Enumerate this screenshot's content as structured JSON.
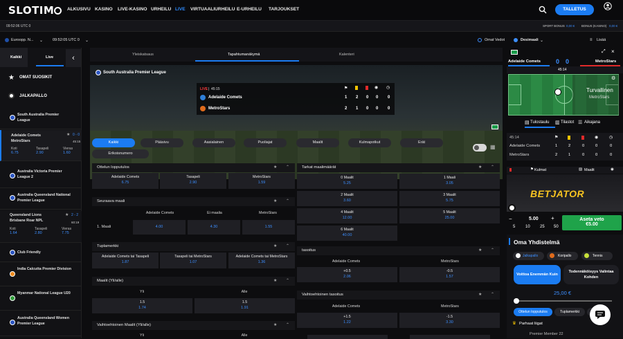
{
  "nav": {
    "logo": "SLOTIM",
    "items": [
      "ALKUSIVU",
      "KASINO",
      "LIVE-KASINO",
      "URHEILU",
      "LIVE",
      "VIRTUAALIURHEILU",
      "E-URHEILU",
      "TARJOUKSET"
    ],
    "deposit": "TALLETUS"
  },
  "subbar": {
    "time_left": "09:52:06 UTC 0",
    "bonus_sport": "SPORT BONUS",
    "bonus_sport_val": "0,00 €",
    "bonus_casino": "BONUS (KASINO)",
    "bonus_casino_val": "0,00 €"
  },
  "filterbar": {
    "region": "Euroopp. N...",
    "time": "09:52:05 UTC 0",
    "own_bets": "Omat Vedot",
    "decimal": "Desimaali",
    "more": "Lisää"
  },
  "sidebar": {
    "tab_all": "Kaikki",
    "tab_live": "Live",
    "favorites": "OMAT SUOSIKIT",
    "football": "JALKAPALLO",
    "items": [
      {
        "label": "South Australia Premier League"
      },
      {
        "label": "Adelaide Comets",
        "label2": "MetroStars",
        "score": "0 - 0",
        "time": "45:15",
        "odds": [
          {
            "l": "Koti",
            "v": "6.75"
          },
          {
            "l": "Tasapeli",
            "v": "2.90"
          },
          {
            "l": "Vieras",
            "v": "1.60"
          }
        ]
      },
      {
        "label": "Australia Victoria Premier League 2"
      },
      {
        "label": "Australia Queensland National Premier League"
      },
      {
        "label": "Queensland Lions",
        "label2": "Brisbane Roar NPL",
        "score": "2 - 2",
        "time": "60:19",
        "odds": [
          {
            "l": "Koti",
            "v": "1.64"
          },
          {
            "l": "Tasapeli",
            "v": "2.80"
          },
          {
            "l": "Vieras",
            "v": "7.75"
          }
        ]
      },
      {
        "label": "Club Friendly"
      },
      {
        "label": "India Calcutta Premier Division"
      },
      {
        "label": "Myanmar National League U20"
      },
      {
        "label": "Australia Queensland Women Premier League"
      }
    ]
  },
  "middle": {
    "tabs": [
      "Yleiskatsaus",
      "Tapahtumanäkymä",
      "Kalenteri"
    ],
    "league": "South Australia Premier League",
    "live": "LIVE",
    "live_time": "45:15",
    "teams": [
      {
        "name": "Adelaide Comets",
        "s": [
          "1",
          "2",
          "0",
          "0",
          "0"
        ]
      },
      {
        "name": "MetroStars",
        "s": [
          "2",
          "1",
          "0",
          "0",
          "0"
        ]
      }
    ],
    "chips": [
      "Kaikki",
      "Pääsivu",
      "Aasialainen",
      "Puoliajat",
      "Maalit",
      "Kulmapotkut",
      "Erät",
      "Erikoisnumero"
    ],
    "m1": {
      "title": "Ottelun lopputulos",
      "cells": [
        {
          "n": "Adelaide Comets",
          "o": "6.75"
        },
        {
          "n": "Tasapeli",
          "o": "2.90"
        },
        {
          "n": "MetroStars",
          "o": "1.59"
        }
      ]
    },
    "m2": {
      "title": "Seuraava maali",
      "cols": [
        "Adelaide Comets",
        "Ei maalia",
        "MetroStars"
      ],
      "row": "1. Maali",
      "odds": [
        "4.00",
        "4.30",
        "1.55"
      ]
    },
    "m3": {
      "title": "Tuplamerkki",
      "cells": [
        {
          "n": "Adelaide Comets tai Tasapeli",
          "o": "1.87"
        },
        {
          "n": "Tasapeli tai MetroStars",
          "o": "1.07"
        },
        {
          "n": "Adelaide Comets tai MetroStars",
          "o": "1.36"
        }
      ]
    },
    "m4": {
      "title": "Maalit (Yli/alle)",
      "cols": [
        "Yli",
        "Alle"
      ],
      "line": "1.5",
      "odds": [
        "1.74",
        "1.91"
      ]
    },
    "m5": {
      "title": "Vaihtoehtoinen Maalit (Yli/alle)",
      "cols": [
        "Yli",
        "Alle"
      ]
    },
    "r1": {
      "title": "Tarkat maalimäärät",
      "cells": [
        {
          "n": "0 Maalit",
          "o": "5.25"
        },
        {
          "n": "1 Maali",
          "o": "3.05"
        },
        {
          "n": "2 Maalit",
          "o": "3.60"
        },
        {
          "n": "3 Maalit",
          "o": "5.75"
        },
        {
          "n": "4 Maalit",
          "o": "12.00"
        },
        {
          "n": "5 Maalit",
          "o": "25.00"
        },
        {
          "n": "6 Maalit",
          "o": "40.00"
        }
      ]
    },
    "r2": {
      "title": "tasoitus",
      "cols": [
        "Adelaide Comets",
        "MetroStars"
      ],
      "cells": [
        {
          "n": "+0.5",
          "o": "2.06"
        },
        {
          "n": "-0.5",
          "o": "1.57"
        }
      ]
    },
    "r3": {
      "title": "Vaihtoehtoinen tasoitus",
      "cols": [
        "Adelaide Comets",
        "MetroStars"
      ],
      "cells": [
        {
          "n": "+1.5",
          "o": "1.22"
        },
        {
          "n": "-1.5",
          "o": "3.30"
        }
      ]
    }
  },
  "right": {
    "home": "Adelaide Comets",
    "away": "MetroStars",
    "hs": "0",
    "as": "0",
    "time": "45:14",
    "pitch_text": "Turvallinen",
    "pitch_team": "MetroStars",
    "tabs": [
      "Tulostaulu",
      "Tilastot",
      "Aikajana"
    ],
    "st_time": "45:14",
    "rows": [
      {
        "n": "Adelaide Comets",
        "s": [
          "1",
          "2",
          "0",
          "0",
          "0"
        ]
      },
      {
        "n": "MetroStars",
        "s": [
          "2",
          "1",
          "0",
          "0",
          "0"
        ]
      }
    ],
    "corners": "Kulmat",
    "goals": "Maalit",
    "brand": "BETJATOR",
    "stake": "5.00",
    "quick": [
      "5",
      "10",
      "25",
      "50"
    ],
    "place": "Aseta veto",
    "place_amt": "€5.00",
    "oma": "Oma Yhdistelmä",
    "sports": [
      "Jalkapallo",
      "Koripallo",
      "Tennis"
    ],
    "opt1": "Voittoa Enemmän Kuin",
    "opt2": "Todennäköisyys Valintaa Kohden",
    "amount": "25,00 €",
    "pills": [
      "Ottelun lopputulos",
      "Tuplamerkki",
      "Ta"
    ],
    "leagues": "Parhaat liigat",
    "bottom": "Premier Member 22"
  },
  "colors": {
    "accent": "#1b7cf2",
    "odds": "#3d8fff",
    "green": "#1fa34a"
  }
}
